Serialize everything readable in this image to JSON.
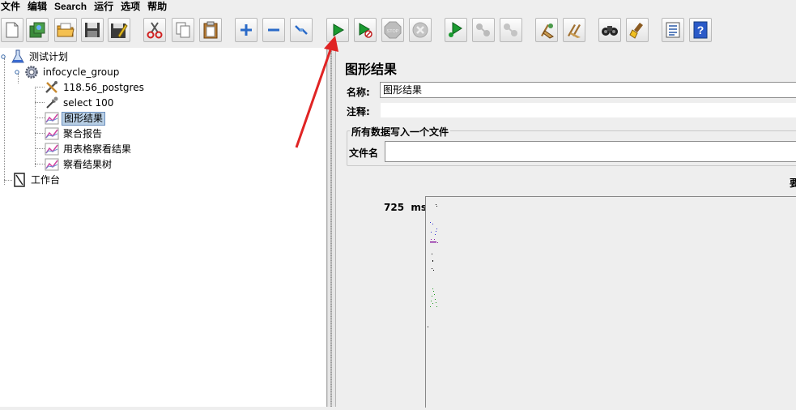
{
  "menu": [
    "文件",
    "编辑",
    "Search",
    "运行",
    "选项",
    "帮助"
  ],
  "toolbar": [
    {
      "name": "new-icon"
    },
    {
      "name": "templates-icon"
    },
    {
      "name": "open-icon"
    },
    {
      "name": "save-icon"
    },
    {
      "name": "save-as-icon"
    },
    {
      "name": "cut-icon"
    },
    {
      "name": "copy-icon"
    },
    {
      "name": "paste-icon"
    },
    {
      "name": "expand-icon"
    },
    {
      "name": "collapse-icon"
    },
    {
      "name": "toggle-icon"
    },
    {
      "name": "start-icon"
    },
    {
      "name": "start-no-timers-icon"
    },
    {
      "name": "stop-icon"
    },
    {
      "name": "shutdown-icon"
    },
    {
      "name": "remote-start-icon"
    },
    {
      "name": "remote-stop-icon"
    },
    {
      "name": "remote-shutdown-icon"
    },
    {
      "name": "clear-icon"
    },
    {
      "name": "clear-all-icon"
    },
    {
      "name": "search-icon"
    },
    {
      "name": "reset-search-icon"
    },
    {
      "name": "function-helper-icon"
    },
    {
      "name": "help-icon"
    }
  ],
  "stop_label": "STOP",
  "tree": {
    "plan": "测试计划",
    "group": "infocycle_group",
    "items": [
      "118.56_postgres",
      "select 100",
      "图形结果",
      "聚合报告",
      "用表格察看结果",
      "察看结果树"
    ],
    "workbench": "工作台",
    "selected_index": 2
  },
  "panel": {
    "title": "图形结果",
    "name_label": "名称:",
    "name_value": "图形结果",
    "comment_label": "注释:",
    "comment_value": "",
    "group_title": "所有数据写入一个文件",
    "filename_label": "文件名",
    "filename_value": "",
    "right_cut_text": "要"
  },
  "graph": {
    "y_label": "725  ms"
  },
  "colors": {
    "accent_red": "#e02424",
    "selection_bg": "#b8cfe5"
  }
}
